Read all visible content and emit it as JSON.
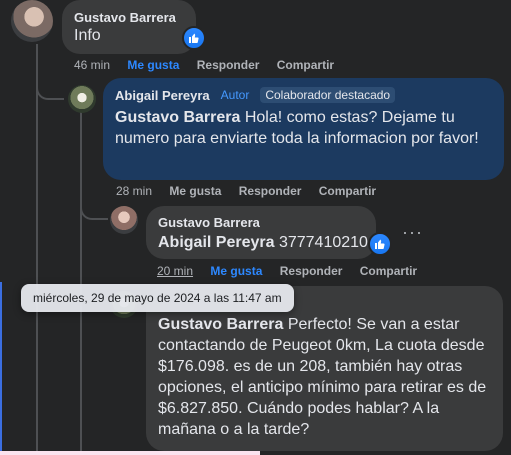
{
  "comments": [
    {
      "author": "Gustavo Barrera",
      "text": "Info",
      "time": "46 min",
      "like_label": "Me gusta",
      "reply_label": "Responder",
      "share_label": "Compartir"
    },
    {
      "author": "Abigail Pereyra",
      "author_badge": "Autor",
      "contributor_badge": "Colaborador destacado",
      "mention": "Gustavo Barrera",
      "text": " Hola! como estas? Dejame tu numero para enviarte toda la informacion por favor!",
      "time": "28 min",
      "like_label": "Me gusta",
      "reply_label": "Responder",
      "share_label": "Compartir"
    },
    {
      "author": "Gustavo Barrera",
      "mention": "Abigail Pereyra",
      "text": " 3777410210",
      "time": "20 min",
      "like_label": "Me gusta",
      "reply_label": "Responder",
      "share_label": "Compartir",
      "more_label": "···"
    },
    {
      "mention": "Gustavo Barrera",
      "text": " Perfecto! Se van a estar contactando de Peugeot 0km, La cuota desde $176.098. es de un 208, también hay otras opciones, el anticipo mínimo para retirar es de $6.827.850. Cuándo podes hablar? A la mañana o a la tarde?"
    }
  ],
  "tooltip": "miércoles, 29 de mayo de 2024 a las 11:47 am",
  "colors": {
    "background": "#242526",
    "bubble": "#3a3b3c",
    "highlight_bubble": "#1c3a60",
    "like_blue": "#2d88ff"
  },
  "icons": [
    "thumbs-up-icon",
    "more-options-icon"
  ]
}
